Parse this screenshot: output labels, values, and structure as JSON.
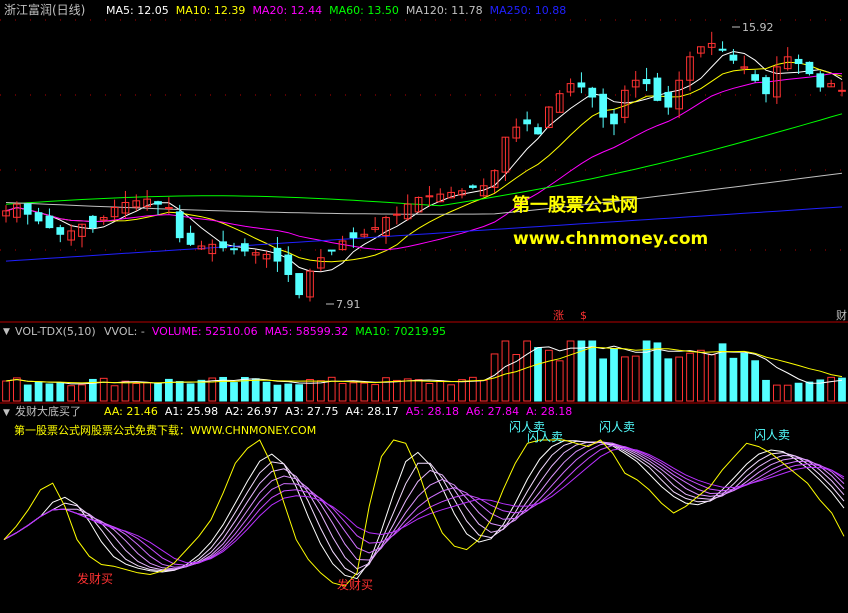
{
  "colors": {
    "background": "#000000",
    "up": "#ff3232",
    "down": "#54ffff",
    "separator": "#b40000",
    "grid": "#b40000",
    "ma5": "#ffffff",
    "ma10": "#ffff00",
    "ma20": "#ff00ff",
    "ma60": "#00ff00",
    "ma120": "#c0c0c0",
    "ma250": "#2020ff",
    "watermark": "#ffff00",
    "label_gray": "#c0c0c0",
    "indicator_text": "#ffff00",
    "sell_text": "#54ffff",
    "buy_text": "#ff3232"
  },
  "panels": {
    "price": {
      "title": "浙江富润(日线)",
      "legend": [
        {
          "key": "ma5",
          "label": "MA5: 12.05"
        },
        {
          "key": "ma10",
          "label": "MA10: 12.39"
        },
        {
          "key": "ma20",
          "label": "MA20: 12.44"
        },
        {
          "key": "ma60",
          "label": "MA60: 13.50"
        },
        {
          "key": "ma120",
          "label": "MA120: 11.78"
        },
        {
          "key": "ma250",
          "label": "MA250: 10.88"
        }
      ],
      "high_label": "15.92",
      "low_label": "7.91",
      "watermark_title": "第一股票公式网",
      "watermark_url": "www.chnmoney.com",
      "marker_1": "涨",
      "marker_2": "$",
      "marker_3": "财"
    },
    "volume": {
      "title": "VOL-TDX(5,10)",
      "legend": [
        {
          "key": "label_gray",
          "label": "VVOL: -"
        },
        {
          "key": "ma20",
          "label": "VOLUME: 52510.06"
        },
        {
          "key": "ma20",
          "label": "MA5: 58599.32"
        },
        {
          "key": "ma60",
          "label": "MA10: 70219.95"
        }
      ]
    },
    "indicator": {
      "title": "发财大底买了",
      "legend": [
        {
          "key": "ma10",
          "label": "AA: 21.46"
        },
        {
          "key": "ma5",
          "label": "A1: 25.98"
        },
        {
          "key": "ma5",
          "label": "A2: 26.97"
        },
        {
          "key": "ma5",
          "label": "A3: 27.75"
        },
        {
          "key": "ma5",
          "label": "A4: 28.17"
        },
        {
          "key": "ma20",
          "label": "A5: 28.18"
        },
        {
          "key": "ma20",
          "label": "A6: 27.84"
        },
        {
          "key": "ma20",
          "label": "A: 28.18"
        }
      ],
      "subtitle": "第一股票公式网股票公式免费下载：WWW.CHNMONEY.COM",
      "buy_label": "发财买",
      "sell_label": "闪人卖"
    }
  },
  "chart_data": [
    {
      "type": "candlestick",
      "title": "浙江富润(日线)",
      "high": 15.92,
      "low": 7.91,
      "ylim": [
        7.5,
        16.4
      ],
      "moving_averages": {
        "MA5": 12.05,
        "MA10": 12.39,
        "MA20": 12.44,
        "MA60": 13.5,
        "MA120": 11.78,
        "MA250": 10.88
      },
      "closes": [
        10.7,
        10.9,
        10.6,
        10.4,
        10.2,
        10.0,
        10.1,
        10.3,
        10.2,
        10.5,
        10.8,
        10.95,
        11.0,
        11.05,
        10.9,
        10.8,
        9.9,
        9.7,
        9.65,
        9.7,
        9.6,
        9.55,
        9.5,
        9.45,
        9.4,
        9.2,
        8.8,
        8.2,
        8.9,
        9.3,
        9.5,
        9.8,
        9.9,
        10.0,
        10.2,
        10.5,
        10.6,
        10.9,
        11.1,
        11.15,
        11.2,
        11.25,
        11.3,
        11.4,
        11.45,
        11.9,
        12.9,
        13.2,
        13.3,
        13.0,
        13.8,
        14.2,
        14.5,
        14.4,
        14.1,
        13.5,
        13.3,
        14.3,
        14.6,
        14.5,
        14.0,
        13.8,
        14.6,
        15.3,
        15.6,
        15.7,
        15.5,
        15.2,
        15.0,
        14.6,
        14.2,
        15.0,
        15.3,
        15.1,
        14.8,
        14.4,
        14.5,
        14.3
      ]
    },
    {
      "type": "bar",
      "title": "VOL-TDX(5,10)",
      "series": [
        {
          "name": "VOLUME",
          "value": 52510.06
        },
        {
          "name": "MA5",
          "value": 58599.32
        },
        {
          "name": "MA10",
          "value": 70219.95
        }
      ]
    },
    {
      "type": "line",
      "title": "发财大底买了",
      "series": [
        {
          "name": "AA",
          "value": 21.46
        },
        {
          "name": "A1",
          "value": 25.98
        },
        {
          "name": "A2",
          "value": 26.97
        },
        {
          "name": "A3",
          "value": 27.75
        },
        {
          "name": "A4",
          "value": 28.17
        },
        {
          "name": "A5",
          "value": 28.18
        },
        {
          "name": "A6",
          "value": 27.84
        },
        {
          "name": "A",
          "value": 28.18
        }
      ],
      "signals": [
        {
          "label": "发财买",
          "occurrences": 2
        },
        {
          "label": "闪人卖",
          "occurrences": 4
        }
      ],
      "aa_series": [
        40,
        48,
        58,
        70,
        74,
        60,
        40,
        30,
        25,
        24,
        22,
        20,
        19,
        21,
        26,
        34,
        42,
        52,
        68,
        86,
        95,
        100,
        85,
        62,
        40,
        28,
        20,
        14,
        12,
        20,
        60,
        90,
        100,
        98,
        82,
        60,
        44,
        36,
        34,
        40,
        52,
        70,
        86,
        98,
        100,
        100,
        100,
        98,
        96,
        100,
        92,
        80,
        76,
        70,
        62,
        56,
        60,
        66,
        72,
        82,
        90,
        98,
        96,
        92,
        86,
        80,
        74,
        64,
        56,
        42
      ]
    }
  ]
}
